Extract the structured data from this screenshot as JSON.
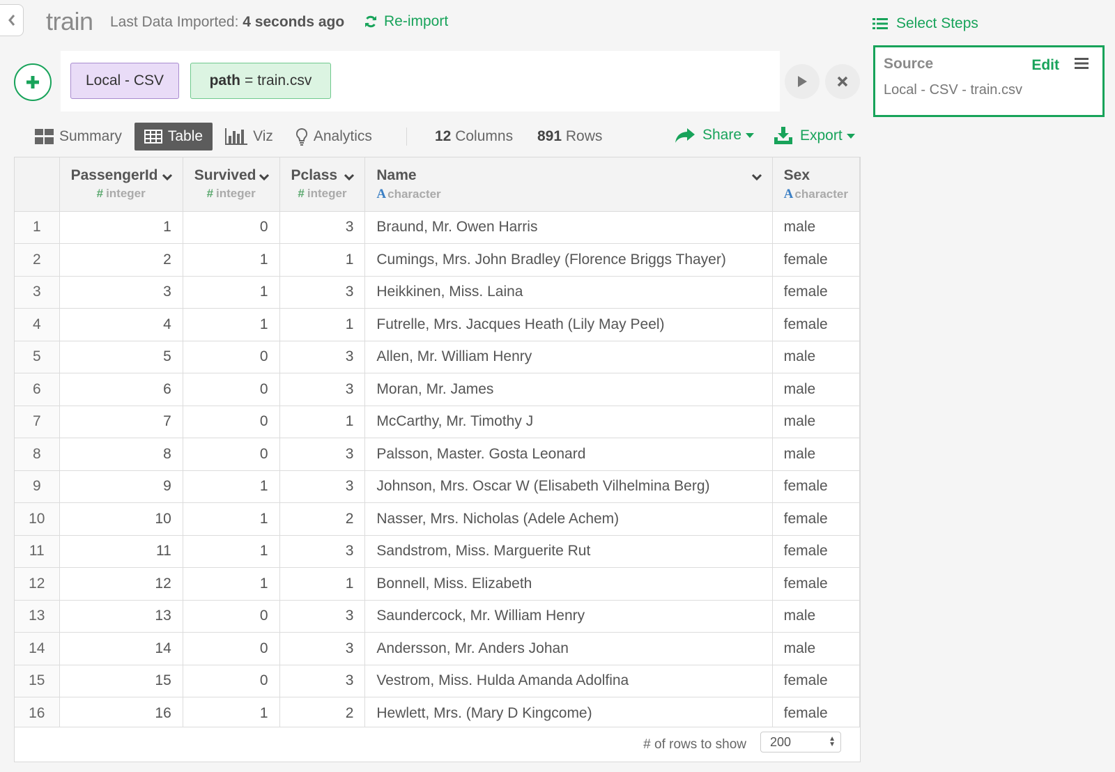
{
  "header": {
    "title": "train",
    "imported_label": "Last Data Imported:",
    "imported_time": "4 seconds ago",
    "reimport_label": "Re-import"
  },
  "steps_panel": {
    "select_steps_label": "Select Steps",
    "source_title": "Source",
    "edit_label": "Edit",
    "source_desc": "Local - CSV - train.csv"
  },
  "command": {
    "token_local": "Local - CSV",
    "token_path_key": "path",
    "token_path_eq": "=",
    "token_path_value": "train.csv"
  },
  "tabs": [
    {
      "label": "Summary",
      "icon": "summary-icon"
    },
    {
      "label": "Table",
      "icon": "table-icon",
      "active": true
    },
    {
      "label": "Viz",
      "icon": "bar-chart-icon"
    },
    {
      "label": "Analytics",
      "icon": "lightbulb-icon"
    }
  ],
  "stats": {
    "columns_count": "12",
    "columns_label": "Columns",
    "rows_count": "891",
    "rows_label": "Rows"
  },
  "actions": {
    "share_label": "Share",
    "export_label": "Export"
  },
  "table": {
    "columns": [
      {
        "name": "PassengerId",
        "type": "integer",
        "type_icon": "#"
      },
      {
        "name": "Survived",
        "type": "integer",
        "type_icon": "#"
      },
      {
        "name": "Pclass",
        "type": "integer",
        "type_icon": "#"
      },
      {
        "name": "Name",
        "type": "character",
        "type_icon": "A"
      },
      {
        "name": "Sex",
        "type": "character",
        "type_icon": "A"
      }
    ],
    "rows": [
      {
        "idx": "1",
        "passengerid": "1",
        "survived": "0",
        "pclass": "3",
        "name": "Braund, Mr. Owen Harris",
        "sex": "male"
      },
      {
        "idx": "2",
        "passengerid": "2",
        "survived": "1",
        "pclass": "1",
        "name": "Cumings, Mrs. John Bradley (Florence Briggs Thayer)",
        "sex": "female"
      },
      {
        "idx": "3",
        "passengerid": "3",
        "survived": "1",
        "pclass": "3",
        "name": "Heikkinen, Miss. Laina",
        "sex": "female"
      },
      {
        "idx": "4",
        "passengerid": "4",
        "survived": "1",
        "pclass": "1",
        "name": "Futrelle, Mrs. Jacques Heath (Lily May Peel)",
        "sex": "female"
      },
      {
        "idx": "5",
        "passengerid": "5",
        "survived": "0",
        "pclass": "3",
        "name": "Allen, Mr. William Henry",
        "sex": "male"
      },
      {
        "idx": "6",
        "passengerid": "6",
        "survived": "0",
        "pclass": "3",
        "name": "Moran, Mr. James",
        "sex": "male"
      },
      {
        "idx": "7",
        "passengerid": "7",
        "survived": "0",
        "pclass": "1",
        "name": "McCarthy, Mr. Timothy J",
        "sex": "male"
      },
      {
        "idx": "8",
        "passengerid": "8",
        "survived": "0",
        "pclass": "3",
        "name": "Palsson, Master. Gosta Leonard",
        "sex": "male"
      },
      {
        "idx": "9",
        "passengerid": "9",
        "survived": "1",
        "pclass": "3",
        "name": "Johnson, Mrs. Oscar W (Elisabeth Vilhelmina Berg)",
        "sex": "female"
      },
      {
        "idx": "10",
        "passengerid": "10",
        "survived": "1",
        "pclass": "2",
        "name": "Nasser, Mrs. Nicholas (Adele Achem)",
        "sex": "female"
      },
      {
        "idx": "11",
        "passengerid": "11",
        "survived": "1",
        "pclass": "3",
        "name": "Sandstrom, Miss. Marguerite Rut",
        "sex": "female"
      },
      {
        "idx": "12",
        "passengerid": "12",
        "survived": "1",
        "pclass": "1",
        "name": "Bonnell, Miss. Elizabeth",
        "sex": "female"
      },
      {
        "idx": "13",
        "passengerid": "13",
        "survived": "0",
        "pclass": "3",
        "name": "Saundercock, Mr. William Henry",
        "sex": "male"
      },
      {
        "idx": "14",
        "passengerid": "14",
        "survived": "0",
        "pclass": "3",
        "name": "Andersson, Mr. Anders Johan",
        "sex": "male"
      },
      {
        "idx": "15",
        "passengerid": "15",
        "survived": "0",
        "pclass": "3",
        "name": "Vestrom, Miss. Hulda Amanda Adolfina",
        "sex": "female"
      },
      {
        "idx": "16",
        "passengerid": "16",
        "survived": "1",
        "pclass": "2",
        "name": "Hewlett, Mrs. (Mary D Kingcome)",
        "sex": "female"
      }
    ]
  },
  "footer": {
    "rows_to_show_label": "# of rows to show",
    "rows_to_show_value": "200"
  },
  "colors": {
    "accent": "#18a35a",
    "local_token_bg": "#e9dcf7",
    "path_token_bg": "#dcf4e2"
  }
}
